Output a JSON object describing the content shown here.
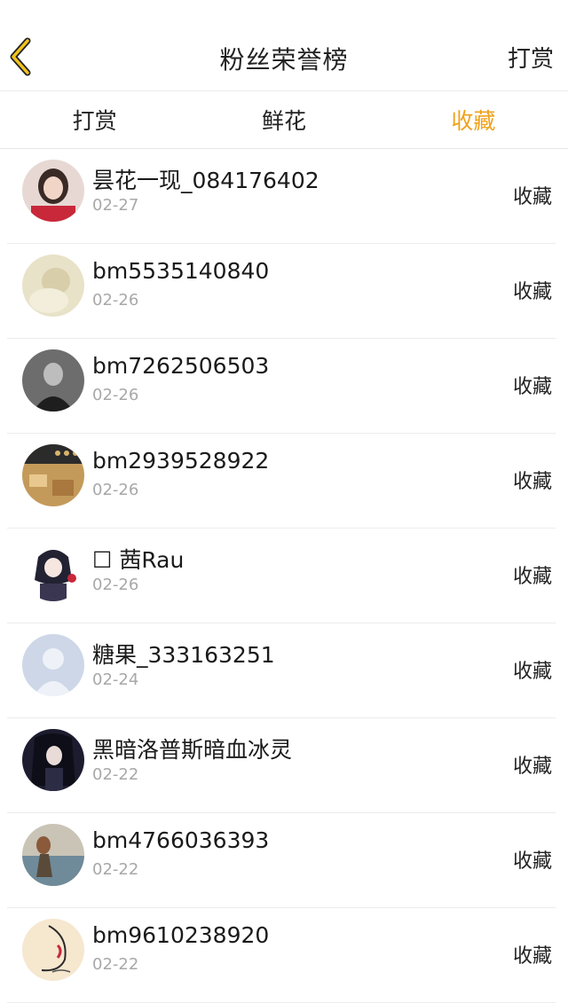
{
  "header": {
    "back_icon": "chevron-left-icon",
    "title": "粉丝荣誉榜",
    "action_label": "打赏",
    "accent_color": "#f0a21c"
  },
  "tabs": [
    {
      "label": "打赏",
      "active": false
    },
    {
      "label": "鲜花",
      "active": false
    },
    {
      "label": "收藏",
      "active": true
    }
  ],
  "fans": [
    {
      "name": "昙花一现_084176402",
      "date": "02-27",
      "action": "收藏"
    },
    {
      "name": "bm5535140840",
      "date": "02-26",
      "action": "收藏"
    },
    {
      "name": "bm7262506503",
      "date": "02-26",
      "action": "收藏"
    },
    {
      "name": "bm2939528922",
      "date": "02-26",
      "action": "收藏"
    },
    {
      "name": "☐ 茜Rau",
      "date": "02-26",
      "action": "收藏"
    },
    {
      "name": "糖果_333163251",
      "date": "02-24",
      "action": "收藏"
    },
    {
      "name": "黑暗洛普斯暗血冰灵",
      "date": "02-22",
      "action": "收藏"
    },
    {
      "name": "bm4766036393",
      "date": "02-22",
      "action": "收藏"
    },
    {
      "name": "bm9610238920",
      "date": "02-22",
      "action": "收藏"
    }
  ]
}
